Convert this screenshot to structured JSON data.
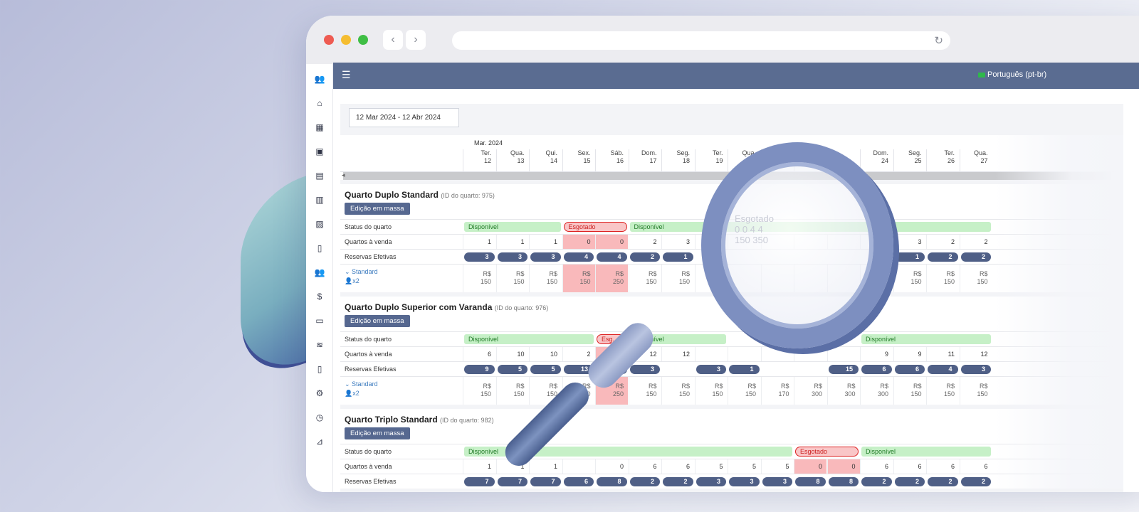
{
  "browser": {
    "back_icon": "chevron-left-icon",
    "forward_icon": "chevron-right-icon",
    "reload_icon": "reload-icon"
  },
  "topbar": {
    "menu_icon": "hamburger-icon",
    "language": "Português (pt-br)"
  },
  "sidebar": {
    "icons": [
      "users-icon",
      "home-icon",
      "building-icon",
      "hotel-icon",
      "calendar-icon",
      "book-icon",
      "image-icon",
      "file-icon",
      "group-icon",
      "dollar-icon",
      "money-icon",
      "database-icon",
      "document-icon",
      "gear-icon",
      "clock-icon",
      "sitemap-icon"
    ]
  },
  "filters": {
    "date_range": "12 Mar 2024 - 12 Abr 2024"
  },
  "calendar": {
    "month": "Mar. 2024",
    "days": [
      {
        "wd": "Ter.",
        "d": "12"
      },
      {
        "wd": "Qua.",
        "d": "13"
      },
      {
        "wd": "Qui.",
        "d": "14"
      },
      {
        "wd": "Sex.",
        "d": "15"
      },
      {
        "wd": "Sáb.",
        "d": "16"
      },
      {
        "wd": "Dom.",
        "d": "17"
      },
      {
        "wd": "Seg.",
        "d": "18"
      },
      {
        "wd": "Ter.",
        "d": "19"
      },
      {
        "wd": "Qua.",
        "d": ""
      },
      {
        "wd": "",
        "d": ""
      },
      {
        "wd": "",
        "d": ""
      },
      {
        "wd": "",
        "d": ""
      },
      {
        "wd": "Dom.",
        "d": "24"
      },
      {
        "wd": "Seg.",
        "d": "25"
      },
      {
        "wd": "Ter.",
        "d": "26"
      },
      {
        "wd": "Qua.",
        "d": "27"
      }
    ]
  },
  "labels": {
    "status": "Status do quarto",
    "for_sale": "Quartos à venda",
    "bookings": "Reservas Efetivas",
    "available": "Disponível",
    "sold_out": "Esgotado",
    "sold_out_short": "Esg...",
    "mass_edit": "Edição em massa",
    "rate_plan": "Standard",
    "guests": "x2",
    "currency": "R$"
  },
  "rooms": [
    {
      "name": "Quarto Duplo Standard",
      "id_text": "(ID do quarto: 975)",
      "for_sale": [
        "1",
        "1",
        "1",
        "0",
        "0",
        "2",
        "3",
        "",
        "",
        "",
        "",
        "",
        "",
        "3",
        "2",
        "2"
      ],
      "bookings": [
        "3",
        "3",
        "3",
        "4",
        "4",
        "2",
        "1",
        "",
        "",
        "",
        "",
        "",
        "",
        "1",
        "2",
        "2"
      ],
      "prices": [
        "150",
        "150",
        "150",
        "150",
        "250",
        "150",
        "150",
        "",
        "",
        "",
        "",
        "",
        "",
        "150",
        "150",
        "150"
      ]
    },
    {
      "name": "Quarto Duplo Superior com Varanda",
      "id_text": "(ID do quarto: 976)",
      "for_sale": [
        "6",
        "10",
        "10",
        "2",
        "0",
        "12",
        "12",
        "",
        "",
        "",
        "",
        "",
        "9",
        "9",
        "11",
        "12"
      ],
      "bookings": [
        "9",
        "5",
        "5",
        "13",
        "15",
        "3",
        "",
        "3",
        "1",
        "",
        "",
        "15",
        "6",
        "6",
        "4",
        "3"
      ],
      "prices": [
        "150",
        "150",
        "150",
        "280",
        "250",
        "150",
        "150",
        "150",
        "150",
        "170",
        "300",
        "300",
        "300",
        "150",
        "150",
        "150"
      ]
    },
    {
      "name": "Quarto Triplo Standard",
      "id_text": "(ID do quarto: 982)",
      "for_sale": [
        "1",
        "1",
        "1",
        "",
        "0",
        "6",
        "6",
        "5",
        "5",
        "5",
        "0",
        "0",
        "6",
        "6",
        "6",
        "6"
      ],
      "bookings": [
        "7",
        "7",
        "7",
        "6",
        "8",
        "2",
        "2",
        "3",
        "3",
        "3",
        "8",
        "8",
        "2",
        "2",
        "2",
        "2"
      ]
    }
  ],
  "magnifier": {
    "icon": "magnifier-icon",
    "zoom_status": "Esgotado",
    "zoom_values": [
      "0",
      "0",
      "4",
      "4"
    ],
    "zoom_prices": [
      "150",
      "350"
    ]
  }
}
